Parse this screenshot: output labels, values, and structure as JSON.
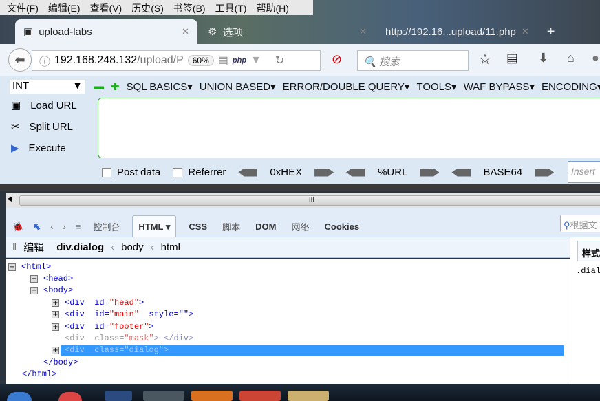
{
  "menu": [
    "文件(F)",
    "编辑(E)",
    "查看(V)",
    "历史(S)",
    "书签(B)",
    "工具(T)",
    "帮助(H)"
  ],
  "tabs": [
    {
      "title": "upload-labs"
    },
    {
      "title": "选项"
    },
    {
      "title": "http://192.16...upload/11.php"
    }
  ],
  "nav": {
    "url_host": "192.168.248.132",
    "url_path": "/upload/P",
    "zoom": "60%",
    "php_label": "php",
    "search_placeholder": "搜索"
  },
  "hackbar": {
    "select": "INT",
    "menus": [
      "SQL BASICS",
      "UNION BASED",
      "ERROR/DOUBLE QUERY",
      "TOOLS",
      "WAF BYPASS",
      "ENCODING"
    ],
    "load": "Load URL",
    "split": "Split URL",
    "execute": "Execute",
    "post": "Post data",
    "referrer": "Referrer",
    "hex": "0xHEX",
    "url": "%URL",
    "base64": "BASE64",
    "insert_placeholder": "Insert"
  },
  "devtools": {
    "tabs": [
      "控制台",
      "HTML",
      "CSS",
      "脚本",
      "DOM",
      "网络",
      "Cookies"
    ],
    "active_tab": "HTML",
    "search_placeholder": "根据文",
    "edit": "编辑",
    "crumbs": [
      "div.dialog",
      "body",
      "html"
    ],
    "side_tab": "样式",
    "side_text": ".dial"
  },
  "tree": [
    {
      "pre": "<html>"
    },
    {
      "pre": "<head>"
    },
    {
      "pre": "<body>"
    },
    {
      "tag": "<div  id=",
      "val": "\"head\"",
      "post": ">"
    },
    {
      "tag": "<div  id=",
      "val": "\"main\"",
      "post": "  style=\"\">"
    },
    {
      "tag": "<div  id=",
      "val": "\"footer\"",
      "post": ">"
    },
    {
      "tag": "<div  class=",
      "val": "\"mask\"",
      "post": "> </div>"
    },
    {
      "tag": "<div  class=",
      "val": "\"dialog\"",
      "post": ">"
    },
    {
      "pre": "</body>"
    },
    {
      "pre": "</html>"
    }
  ],
  "colors": {
    "accent": "#3399ff",
    "attr_value": "#ee0000",
    "tag": "#0000cc"
  }
}
